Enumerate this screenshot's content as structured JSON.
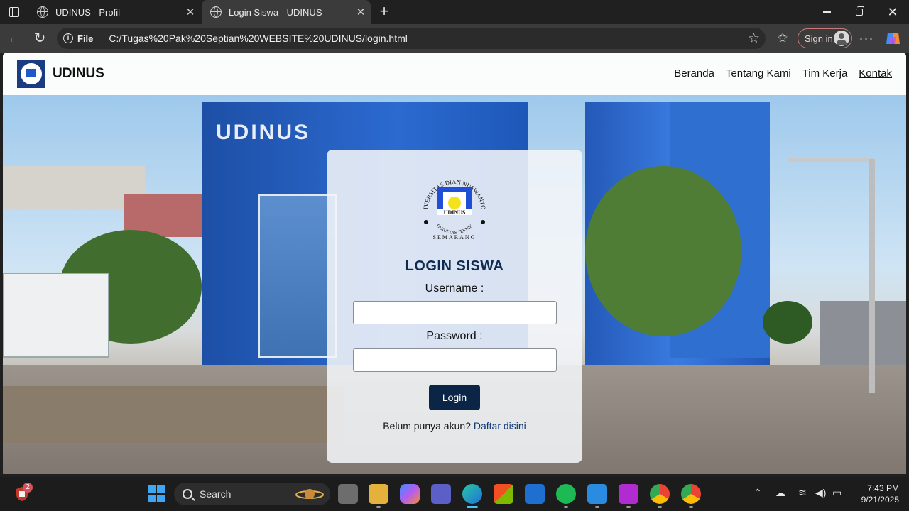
{
  "browser": {
    "tabs": [
      {
        "title": "UDINUS - Profil",
        "active": false
      },
      {
        "title": "Login Siswa - UDINUS",
        "active": true
      }
    ],
    "address": {
      "scheme_label": "File",
      "url": "C:/Tugas%20Pak%20Septian%20WEBSITE%20UDINUS/login.html"
    },
    "signin_label": "Sign in"
  },
  "site": {
    "name": "UDINUS",
    "menu": [
      "Beranda",
      "Tentang Kami",
      "Tim Kerja",
      "Kontak"
    ],
    "active_menu": "Kontak"
  },
  "login": {
    "title": "LOGIN SISWA",
    "username_label": "Username :",
    "password_label": "Password :",
    "username_value": "",
    "password_value": "",
    "button_label": "Login",
    "register_prompt": "Belum punya akun?",
    "register_link": "Daftar disini",
    "emblem_text_top": "UNIVERSITAS DIAN NUSWANTORO",
    "emblem_text_bottom": "FAKULTAS TEKNIK",
    "emblem_city": "SEMARANG",
    "emblem_center": "UDINUS"
  },
  "photo": {
    "building_sign": "UDINUS"
  },
  "taskbar": {
    "search_placeholder": "Search",
    "widget_badge": "2",
    "time": "7:43 PM",
    "date": "9/21/2025"
  },
  "colors": {
    "accent_navy": "#0b2547",
    "site_logo_blue": "#1a3c80",
    "taskbar_active": "#4cc2ff"
  }
}
